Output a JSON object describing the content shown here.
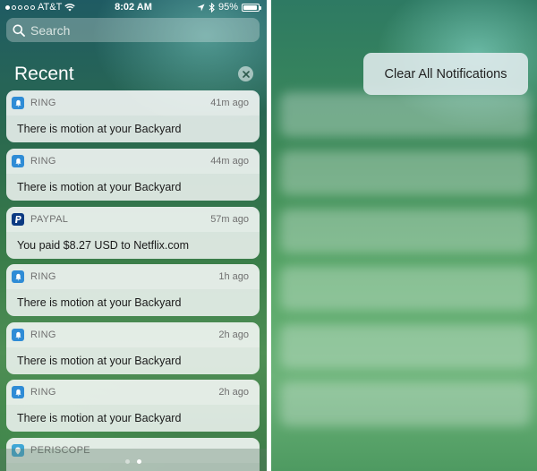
{
  "status_bar": {
    "carrier": "AT&T",
    "time": "8:02 AM",
    "battery_percent": "95%",
    "battery_level": 0.95,
    "signal_dots": [
      true,
      false,
      false,
      false,
      false
    ]
  },
  "search": {
    "placeholder": "Search"
  },
  "recent": {
    "title": "Recent"
  },
  "notifications": [
    {
      "app": "RING",
      "time": "41m ago",
      "message": "There is motion at your Backyard",
      "icon": "bell-icon"
    },
    {
      "app": "RING",
      "time": "44m ago",
      "message": "There is motion at your Backyard",
      "icon": "bell-icon"
    },
    {
      "app": "PAYPAL",
      "time": "57m ago",
      "message": "You paid $8.27 USD to Netflix.com",
      "icon": "paypal-icon"
    },
    {
      "app": "RING",
      "time": "1h ago",
      "message": "There is motion at your Backyard",
      "icon": "bell-icon"
    },
    {
      "app": "RING",
      "time": "2h ago",
      "message": "There is motion at your Backyard",
      "icon": "bell-icon"
    },
    {
      "app": "RING",
      "time": "2h ago",
      "message": "There is motion at your Backyard",
      "icon": "bell-icon"
    },
    {
      "app": "PERISCOPE",
      "time": "",
      "message": "",
      "icon": "periscope-icon"
    }
  ],
  "page_indicator": {
    "count": 2,
    "active": 1
  },
  "right_panel": {
    "clear_all_label": "Clear All Notifications"
  },
  "colors": {
    "ring": "#2f8cd6",
    "paypal": "#0b3a82"
  }
}
